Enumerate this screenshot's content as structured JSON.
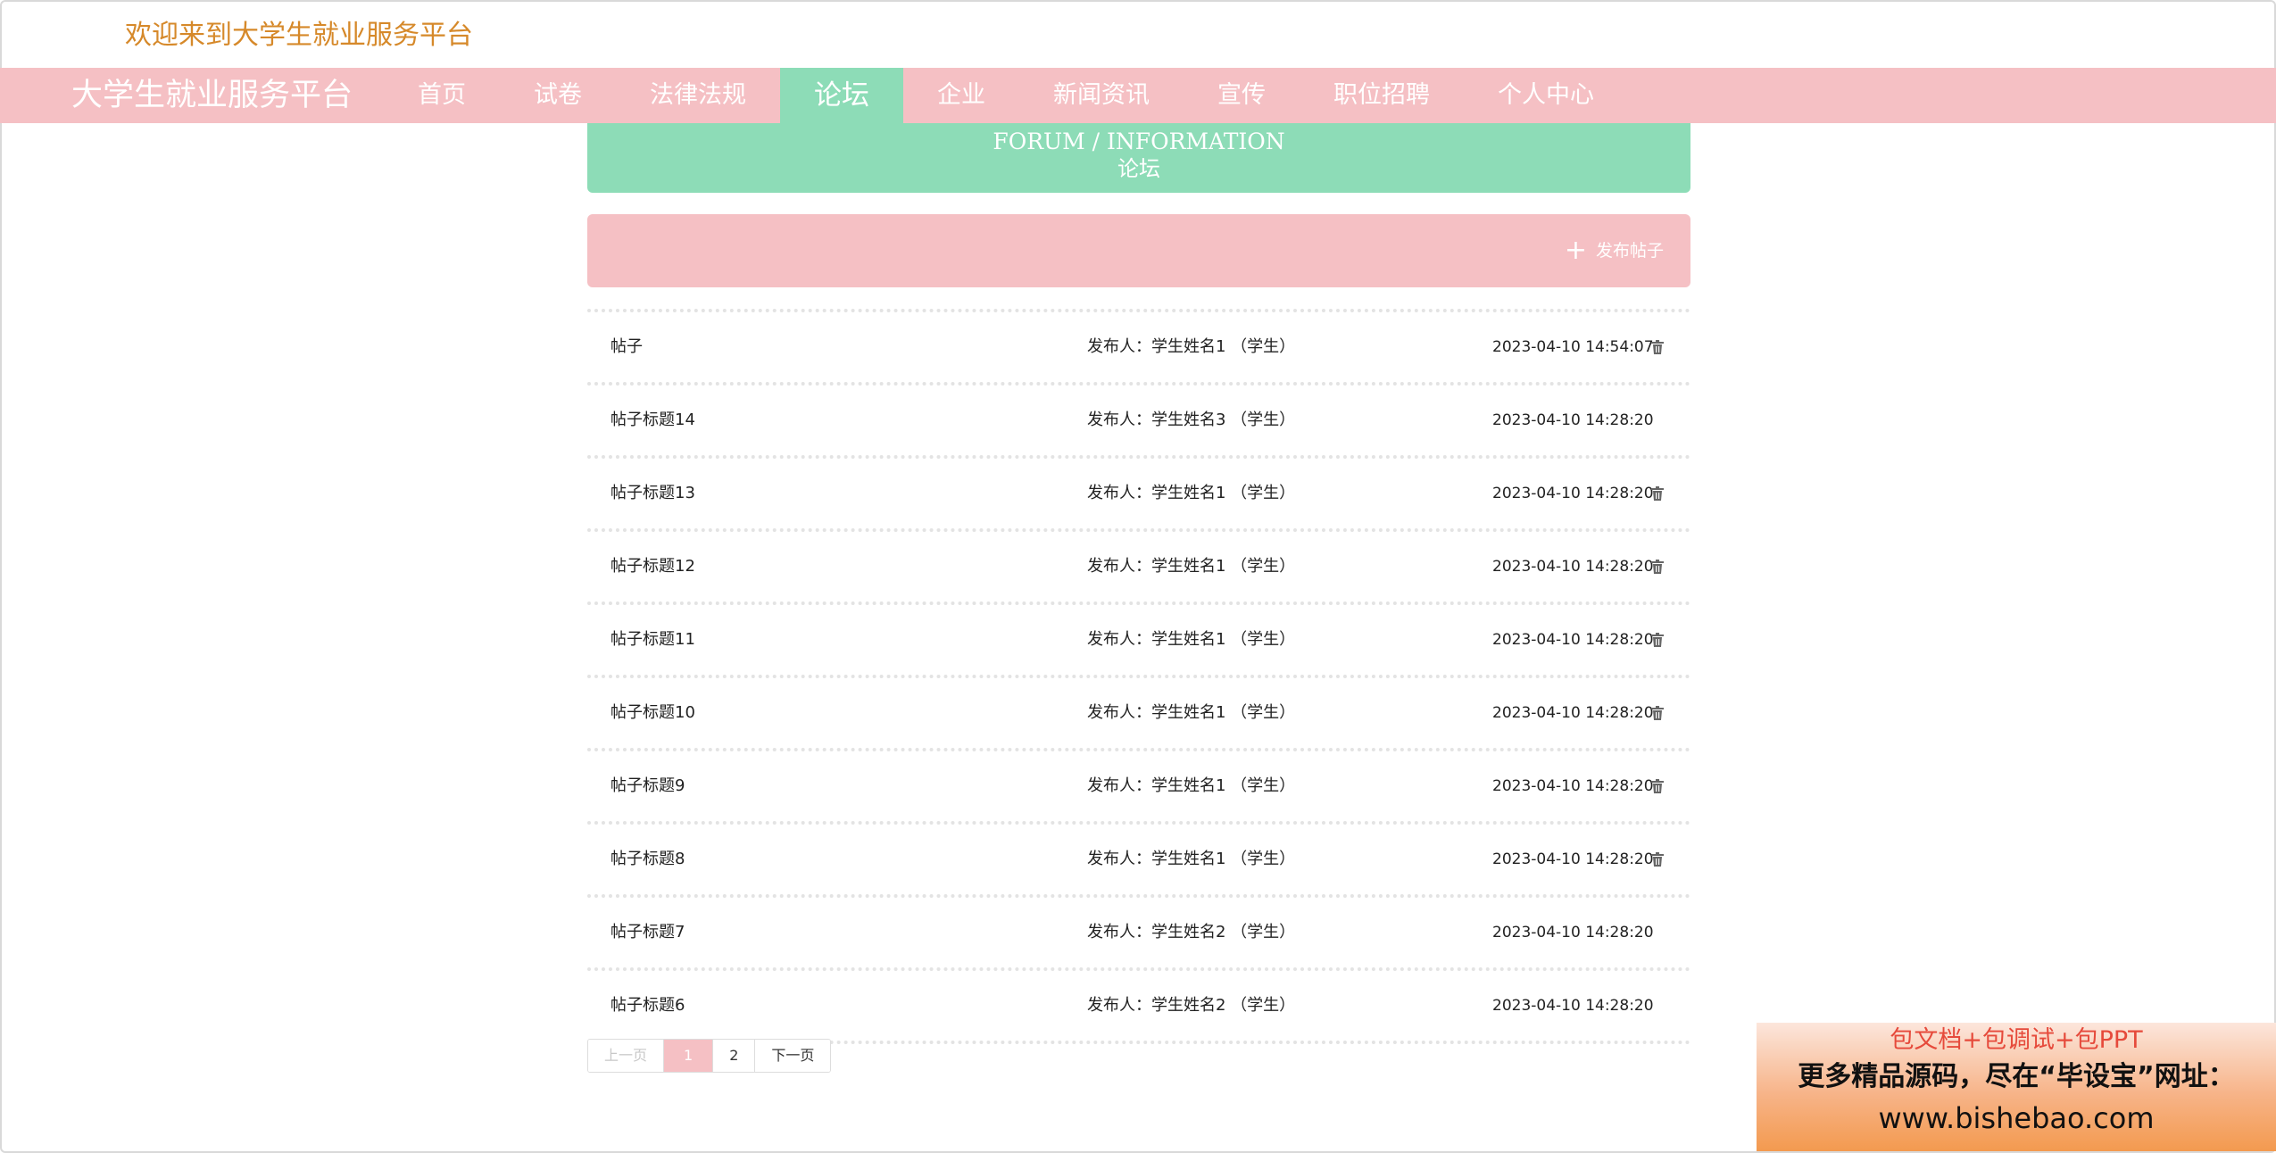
{
  "header": {
    "welcome": "欢迎来到大学生就业服务平台"
  },
  "navbar": {
    "brand": "大学生就业服务平台",
    "items": [
      {
        "label": "首页"
      },
      {
        "label": "试卷"
      },
      {
        "label": "法律法规"
      },
      {
        "label": "论坛",
        "active": true
      },
      {
        "label": "企业"
      },
      {
        "label": "新闻资讯"
      },
      {
        "label": "宣传"
      },
      {
        "label": "职位招聘"
      },
      {
        "label": "个人中心"
      }
    ]
  },
  "banner": {
    "en": "FORUM / INFORMATION",
    "zh": "论坛"
  },
  "toolbar": {
    "publish_label": "发布帖子"
  },
  "colors": {
    "pink": "#f5c0c4",
    "green": "#8ddcb7",
    "welcome": "#d6892a"
  },
  "posts": [
    {
      "title": "帖子",
      "author": "发布人：学生姓名1 （学生）",
      "time": "2023-04-10 14:54:07"
    },
    {
      "title": "帖子标题14",
      "author": "发布人：学生姓名3 （学生）",
      "time": "2023-04-10 14:28:20"
    },
    {
      "title": "帖子标题13",
      "author": "发布人：学生姓名1 （学生）",
      "time": "2023-04-10 14:28:20"
    },
    {
      "title": "帖子标题12",
      "author": "发布人：学生姓名1 （学生）",
      "time": "2023-04-10 14:28:20"
    },
    {
      "title": "帖子标题11",
      "author": "发布人：学生姓名1 （学生）",
      "time": "2023-04-10 14:28:20"
    },
    {
      "title": "帖子标题10",
      "author": "发布人：学生姓名1 （学生）",
      "time": "2023-04-10 14:28:20"
    },
    {
      "title": "帖子标题9",
      "author": "发布人：学生姓名1 （学生）",
      "time": "2023-04-10 14:28:20"
    },
    {
      "title": "帖子标题8",
      "author": "发布人：学生姓名1 （学生）",
      "time": "2023-04-10 14:28:20"
    },
    {
      "title": "帖子标题7",
      "author": "发布人：学生姓名2 （学生）",
      "time": "2023-04-10 14:28:20"
    },
    {
      "title": "帖子标题6",
      "author": "发布人：学生姓名2 （学生）",
      "time": "2023-04-10 14:28:20"
    }
  ],
  "pagination": {
    "prev": "上一页",
    "pages": [
      "1",
      "2"
    ],
    "current": "1",
    "next": "下一页"
  },
  "ad": {
    "line1": "包文档+包调试+包PPT",
    "line2": "更多精品源码，尽在“毕设宝”网址：",
    "line3": "www.bishebao.com"
  }
}
